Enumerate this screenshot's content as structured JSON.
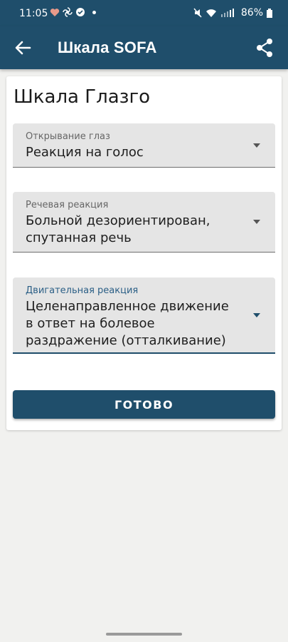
{
  "status_bar": {
    "time": "11:05",
    "battery": "86%"
  },
  "app_bar": {
    "title": "Шкала SOFA"
  },
  "card": {
    "title": "Шкала Глазго",
    "fields": [
      {
        "label": "Открывание глаз",
        "value": "Реакция на голос"
      },
      {
        "label": "Речевая реакция",
        "value": "Больной дезориентирован, спутанная речь"
      },
      {
        "label": "Двигательная реакция",
        "value": "Целенаправленное движение в ответ на болевое раздражение (отталкивание)"
      }
    ],
    "done_label": "ГОТОВО"
  },
  "icons": {
    "back": "arrow-back-icon",
    "share": "share-icon",
    "dropdown": "chevron-down-icon"
  },
  "colors": {
    "primary": "#1f4e6b",
    "field_bg": "#e5e5e5"
  }
}
